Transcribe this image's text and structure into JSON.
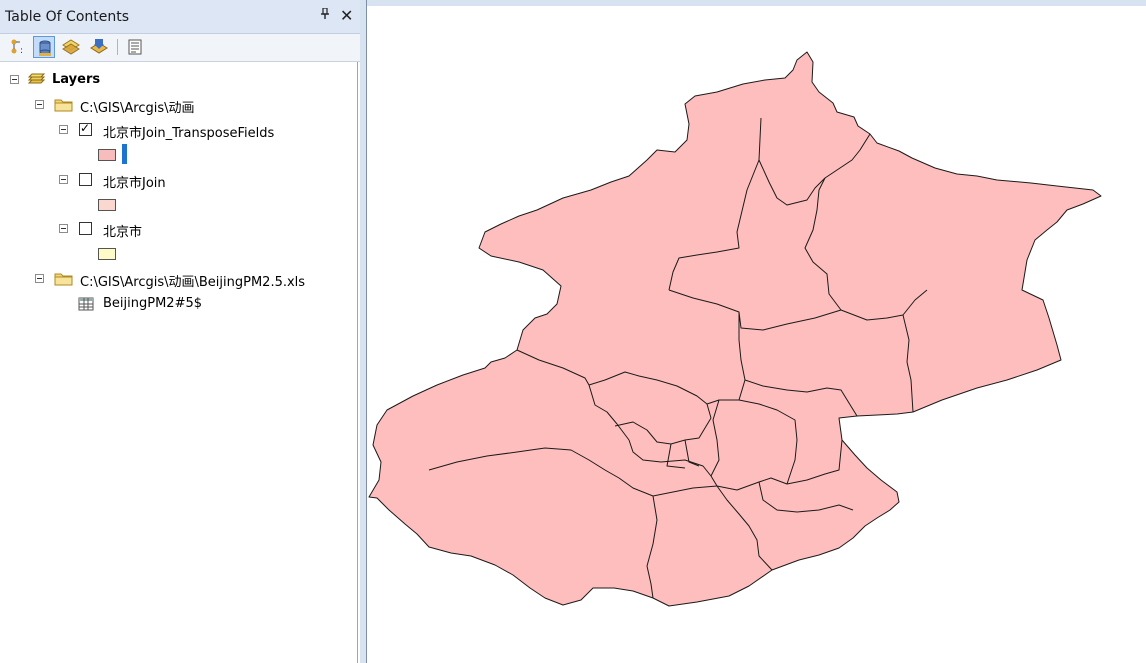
{
  "toc": {
    "title": "Table Of Contents",
    "pin": "ᴪ",
    "close": "✕"
  },
  "toolbar": {
    "buttons": [
      "list-by-drawing-order-icon",
      "list-by-source-icon",
      "list-by-visibility-icon",
      "list-by-selection-icon",
      "options-icon"
    ]
  },
  "tree": {
    "root": "Layers",
    "folder1": "C:\\GIS\\Arcgis\\动画",
    "layer1": "北京市Join_TransposeFields",
    "layer2": "北京市Join",
    "layer3": "北京市",
    "folder2": "C:\\GIS\\Arcgis\\动画\\BeijingPM2.5.xls",
    "table1": "BeijingPM2#5$"
  },
  "colors": {
    "layer1_fill": "#f8bcbc",
    "layer2_fill": "#fbd8cf",
    "layer3_fill": "#fffbc8",
    "map_fill": "#ffbebe",
    "selection": "#1c74d0"
  }
}
